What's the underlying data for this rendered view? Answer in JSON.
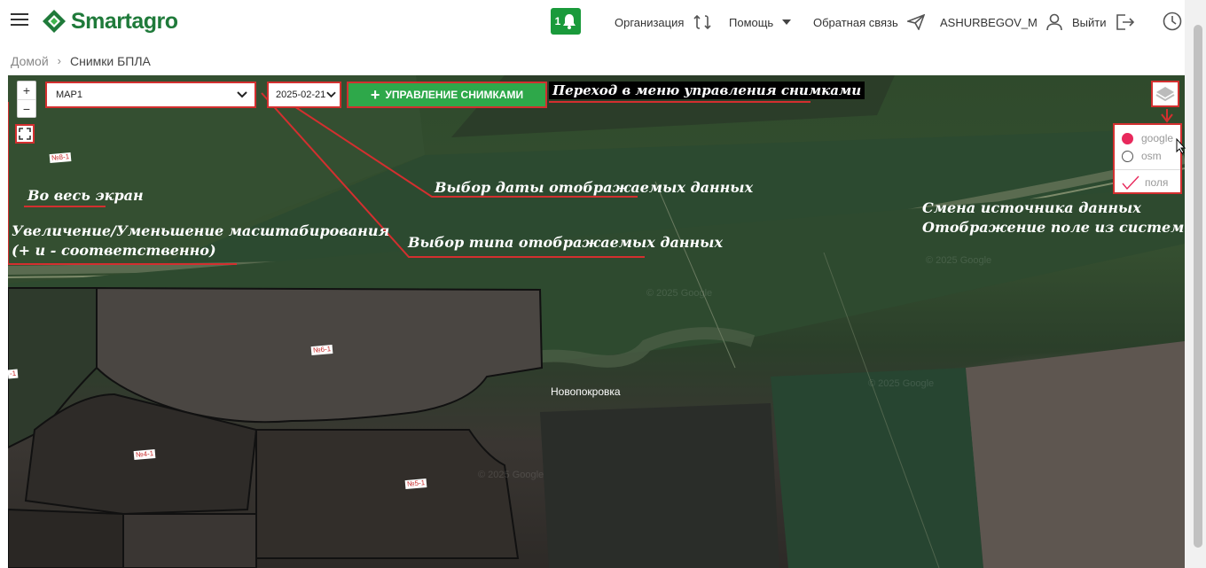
{
  "header": {
    "brand": "Smartagro",
    "notification_count": "1",
    "organization": "Организация",
    "help": "Помощь",
    "feedback": "Обратная связь",
    "username": "ASHURBEGOV_M",
    "logout": "Выйти"
  },
  "breadcrumb": {
    "home": "Домой",
    "current": "Снимки БПЛА"
  },
  "map": {
    "zoom_in": "+",
    "zoom_out": "−",
    "layer_select_value": "MAP1",
    "date_select_value": "2025-02-21",
    "manage_button_label": "УПРАВЛЕНИЕ СНИМКАМИ",
    "city_label": "Новопокровка",
    "watermark": "© 2025 Google",
    "field_labels": [
      "№8-1",
      "№6-1",
      "№4-1",
      "№5-1",
      "-1"
    ],
    "layers": {
      "google": "google",
      "osm": "osm",
      "fields": "поля",
      "selected": "google"
    }
  },
  "annotations": {
    "manage": "Переход в меню управления снимками",
    "fullscreen": "Во весь экран",
    "zoom_line1": "Увеличение/Уменьшение масштабирования",
    "zoom_line2": "(+ и - соответственно)",
    "date": "Выбор даты отображаемых данных",
    "type": "Выбор типа отображаемых данных",
    "source_line1": "Смена источника данных",
    "source_line2": "Отображение поле из системы"
  },
  "colors": {
    "brand_green": "#1a9a3b",
    "annotation_red": "#d32f2f",
    "radio_selected": "#e8295c"
  }
}
